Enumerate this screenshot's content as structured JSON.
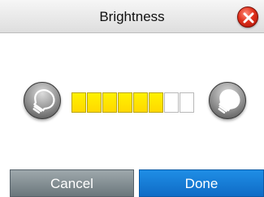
{
  "header": {
    "title": "Brightness",
    "close_icon": "close-x-icon"
  },
  "brightness": {
    "level": 6,
    "max": 8,
    "decrease_icon": "bulb-dim-icon",
    "increase_icon": "bulb-bright-icon",
    "active_color": "#ffe600",
    "inactive_color": "#ffffff"
  },
  "footer": {
    "cancel_label": "Cancel",
    "done_label": "Done",
    "done_color": "#1479d6",
    "cancel_color": "#7f8a8f"
  }
}
